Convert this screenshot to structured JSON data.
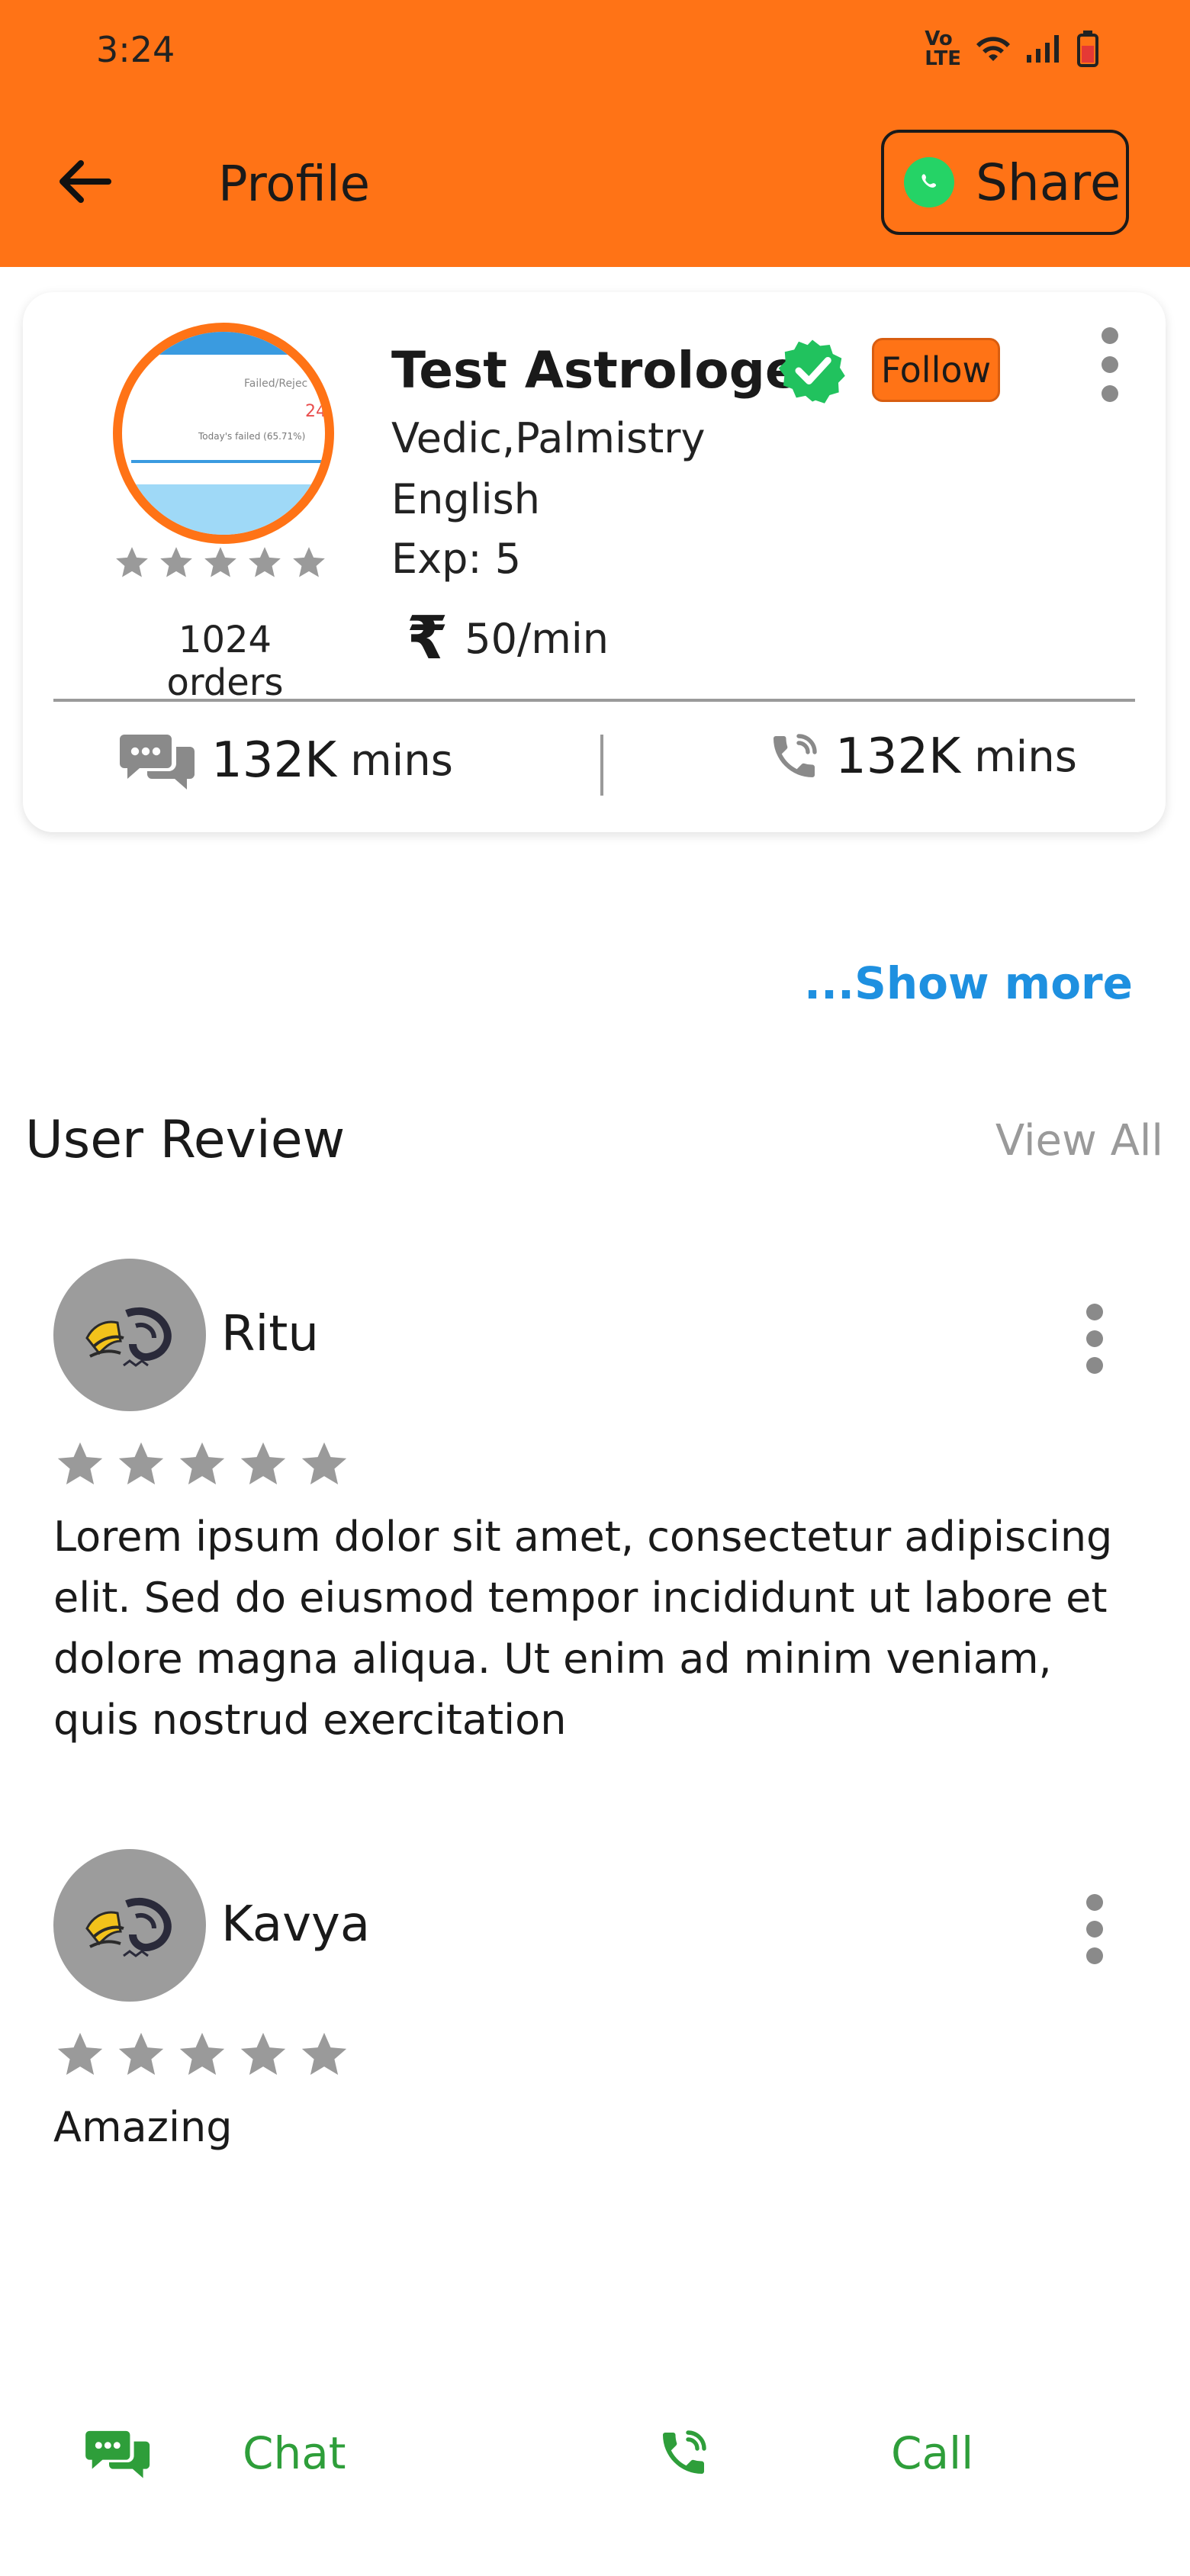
{
  "status_bar": {
    "time": "3:24"
  },
  "header": {
    "title": "Profile",
    "share_label": "Share"
  },
  "profile": {
    "name": "Test Astrologer",
    "follow_label": "Follow",
    "skills": "Vedic,Palmistry",
    "language": "English",
    "experience": "Exp: 5",
    "currency_symbol": "₹",
    "price": "50/min",
    "orders": "1024 orders",
    "rating_stars": 5,
    "chat_minutes": "132K",
    "call_minutes": "132K",
    "minutes_unit": "mins",
    "avatar_preview": {
      "line1": "Failed/Rejec",
      "line2": "24",
      "line3": "Today's failed (65.71%)"
    }
  },
  "show_more_label": "...Show more",
  "reviews_section": {
    "title": "User Review",
    "view_all_label": "View All",
    "items": [
      {
        "name": "Ritu",
        "stars": 5,
        "text": "Lorem ipsum dolor sit amet, consectetur adipiscing elit. Sed do eiusmod tempor incididunt ut labore et dolore magna aliqua. Ut enim ad minim veniam, quis nostrud exercitation"
      },
      {
        "name": "Kavya",
        "stars": 5,
        "text": "Amazing"
      }
    ]
  },
  "bottom_bar": {
    "chat_label": "Chat",
    "call_label": "Call"
  },
  "colors": {
    "accent": "#ff7316",
    "link": "#1e90e0",
    "action_green": "#2e9e3a",
    "verified_green": "#21c25e",
    "star_gray": "#9a9a9a"
  }
}
